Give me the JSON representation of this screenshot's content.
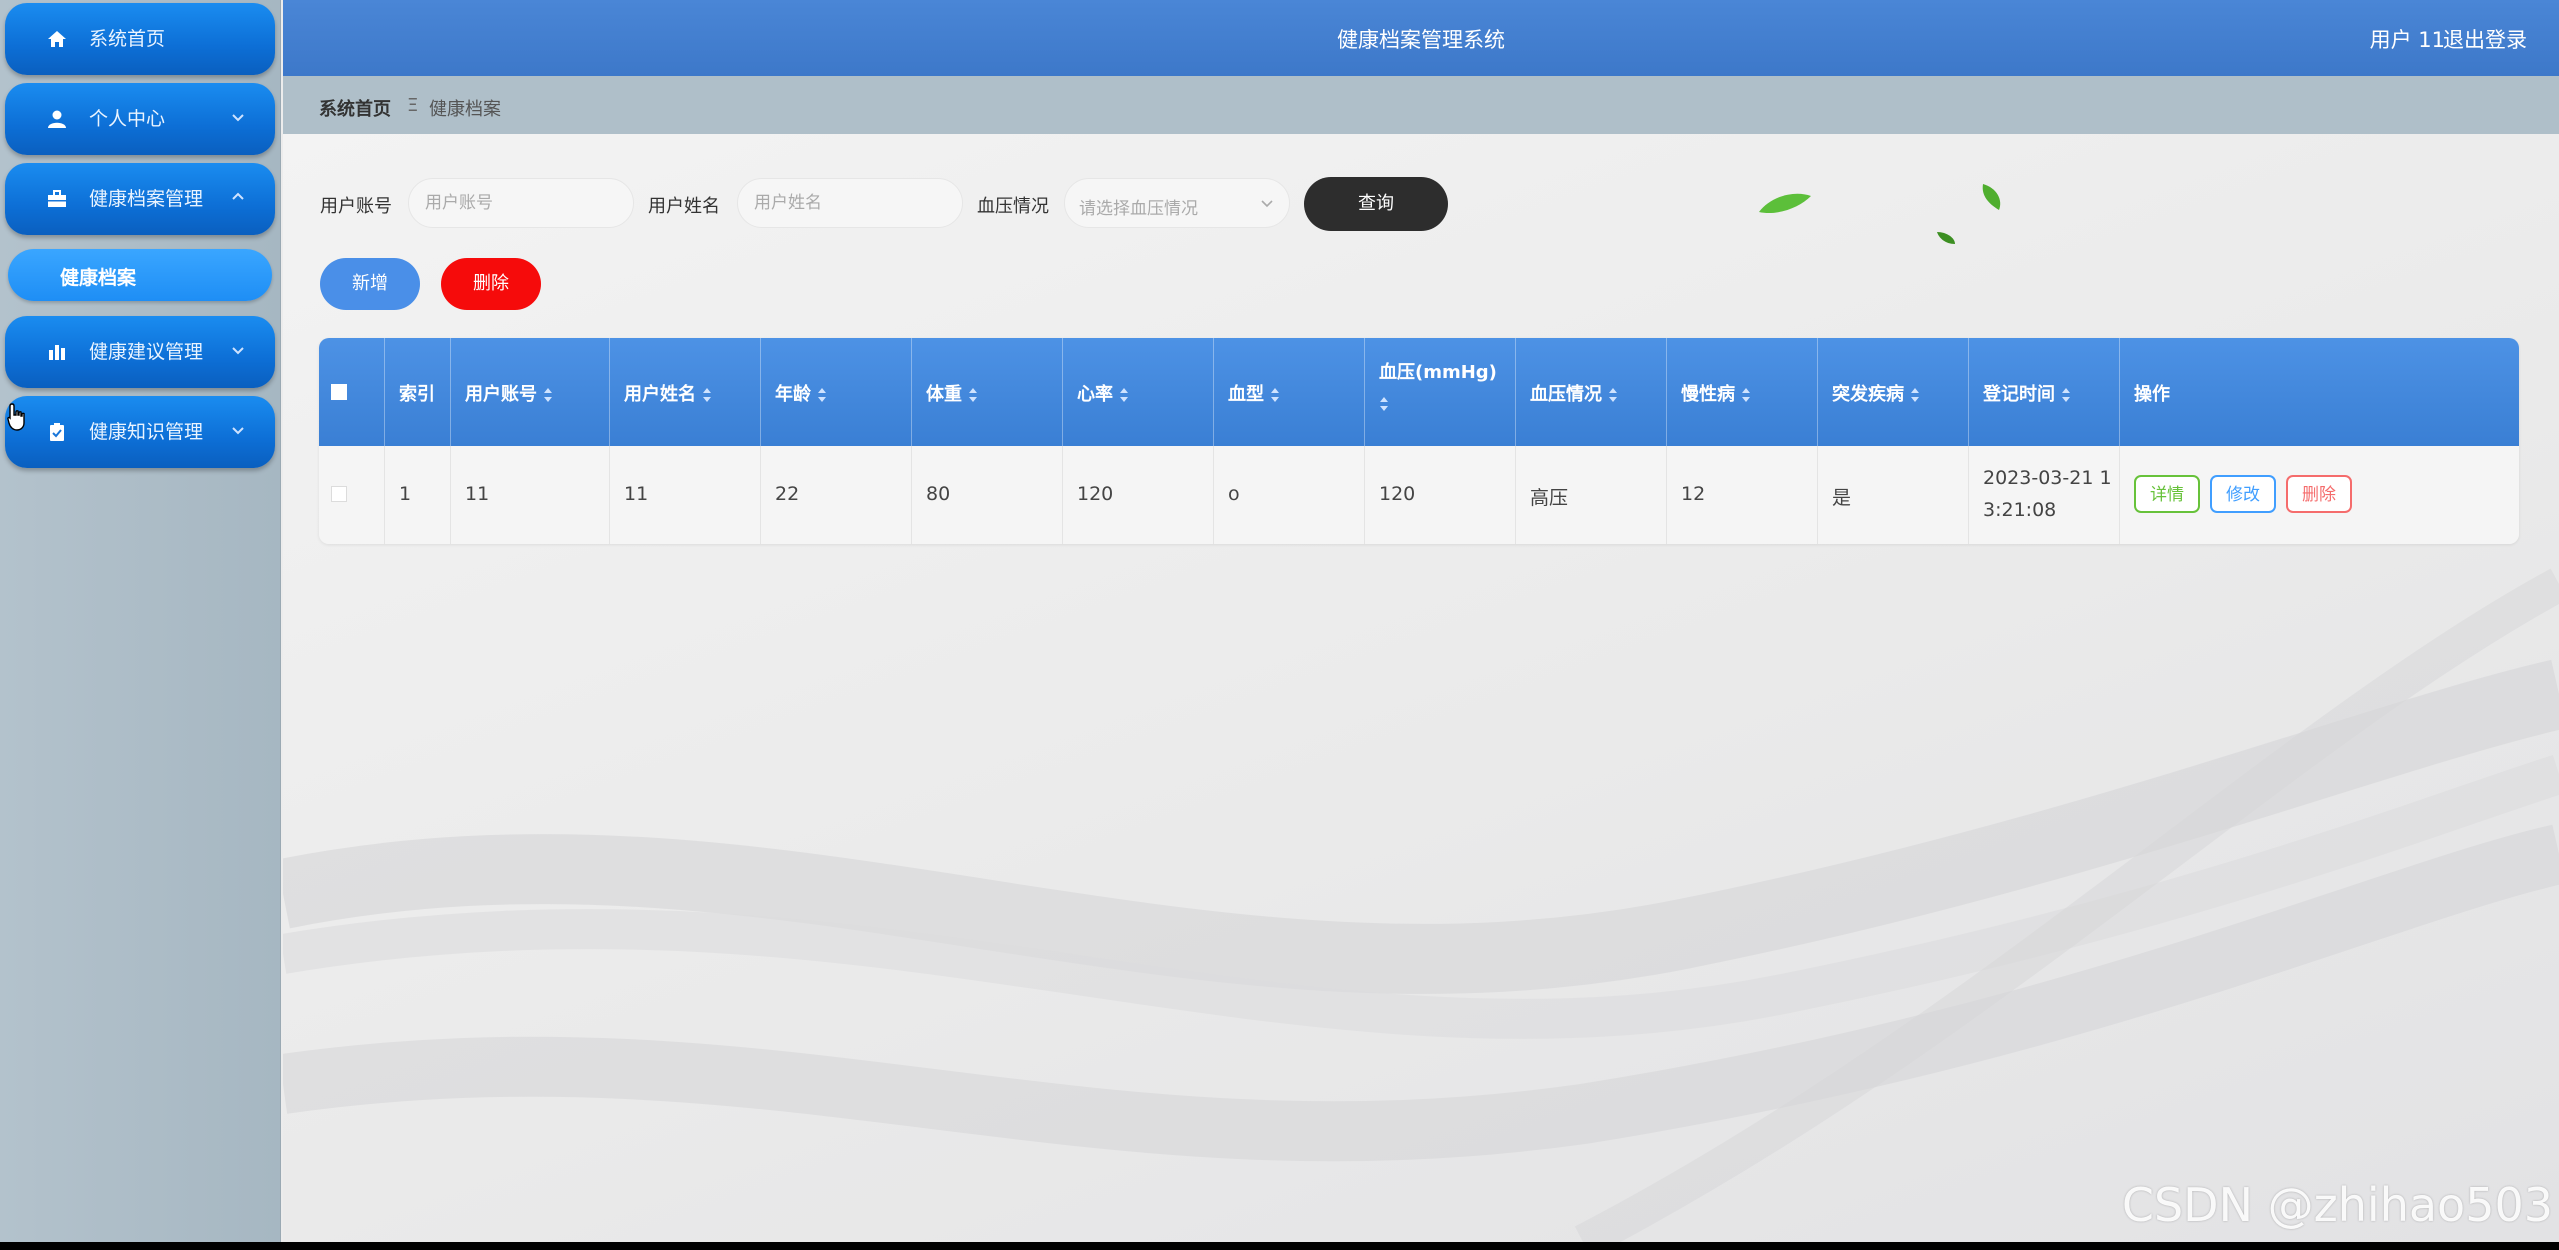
{
  "app": {
    "title": "健康档案管理系统",
    "user": "用户 11",
    "logout": "退出登录"
  },
  "sidebar": {
    "items": [
      {
        "label": "系统首页",
        "icon": "home-icon"
      },
      {
        "label": "个人中心",
        "icon": "user-icon"
      },
      {
        "label": "健康档案管理",
        "icon": "briefcase-icon"
      },
      {
        "label": "健康档案",
        "icon": ""
      },
      {
        "label": "健康建议管理",
        "icon": "chart-icon"
      },
      {
        "label": "健康知识管理",
        "icon": "clipboard-icon"
      }
    ]
  },
  "breadcrumb": {
    "home": "系统首页",
    "separator": "Ξ",
    "current": "健康档案"
  },
  "search": {
    "account_label": "用户账号",
    "account_placeholder": "用户账号",
    "name_label": "用户姓名",
    "name_placeholder": "用户姓名",
    "bp_label": "血压情况",
    "bp_placeholder": "请选择血压情况",
    "query_button": "查询"
  },
  "actions": {
    "add": "新增",
    "delete": "删除"
  },
  "table": {
    "columns": [
      "索引",
      "用户账号",
      "用户姓名",
      "年龄",
      "体重",
      "心率",
      "血型",
      "血压(mmHg)",
      "血压情况",
      "慢性病",
      "突发疾病",
      "登记时间",
      "操作"
    ],
    "rows": [
      {
        "index": "1",
        "account": "11",
        "name": "11",
        "age": "22",
        "weight": "80",
        "heart_rate": "120",
        "blood_type": "o",
        "blood_pressure": "120",
        "bp_status": "高压",
        "chronic": "12",
        "sudden": "是",
        "time_line1": "2023-03-21 1",
        "time_line2": "3:21:08",
        "op_detail": "详情",
        "op_edit": "修改",
        "op_delete": "删除"
      }
    ]
  },
  "watermark": "CSDN @zhihao503",
  "colors": {
    "primary": "#3d78c9",
    "sidebar_item": "#0d6fd6",
    "danger": "#f60b0b",
    "detail": "#67c23a",
    "edit": "#409eff",
    "delete": "#f56c6c"
  }
}
